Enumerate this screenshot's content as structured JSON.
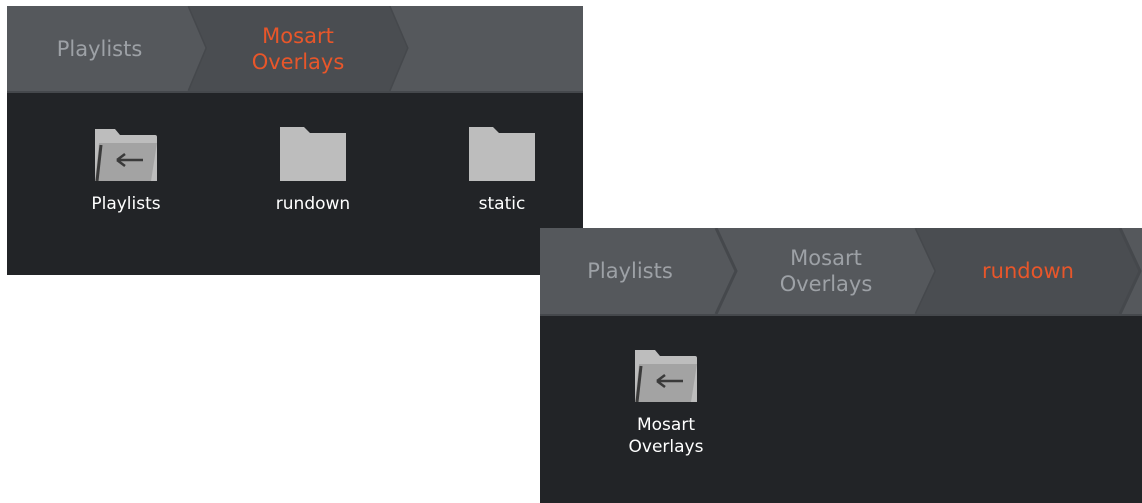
{
  "colors": {
    "panel_bg": "#222427",
    "breadcrumb_bg": "#55585c",
    "breadcrumb_text": "#9da1a6",
    "breadcrumb_active": "#e8562a",
    "folder_icon": "#bdbdbd",
    "item_label": "#ffffff"
  },
  "panel_a": {
    "breadcrumb": [
      {
        "label": "Playlists",
        "active": false
      },
      {
        "label": "Mosart\nOverlays",
        "active": true
      }
    ],
    "items": [
      {
        "label": "Playlists",
        "icon": "folder-up-icon"
      },
      {
        "label": "rundown",
        "icon": "folder-icon"
      },
      {
        "label": "static",
        "icon": "folder-icon"
      }
    ]
  },
  "panel_b": {
    "breadcrumb": [
      {
        "label": "Playlists",
        "active": false
      },
      {
        "label": "Mosart\nOverlays",
        "active": false
      },
      {
        "label": "rundown",
        "active": true
      }
    ],
    "items": [
      {
        "label": "Mosart\nOverlays",
        "icon": "folder-up-icon"
      }
    ]
  }
}
